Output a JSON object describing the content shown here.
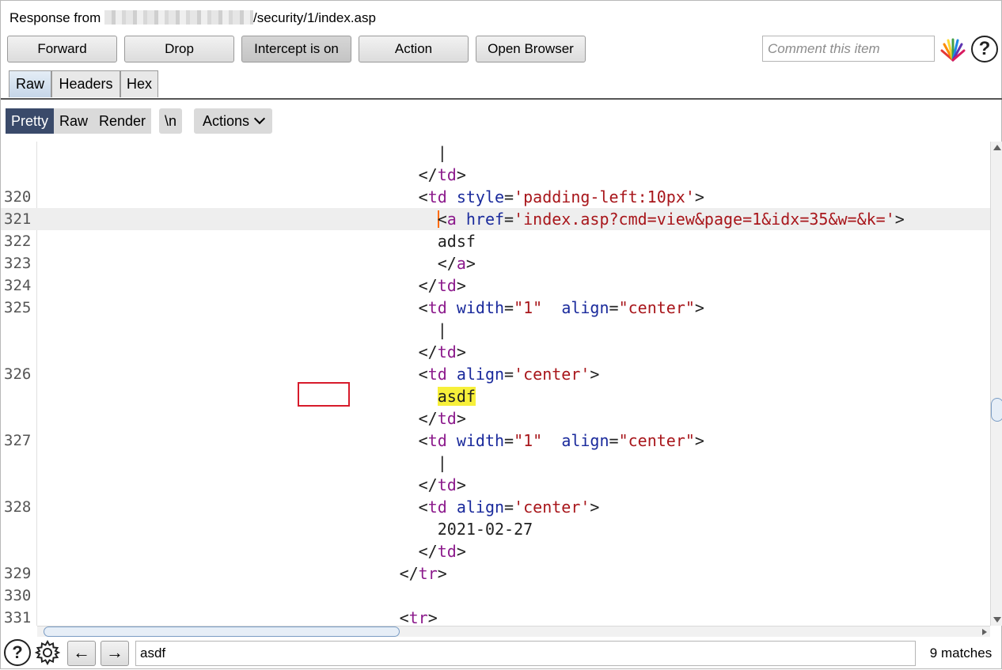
{
  "response": {
    "label_prefix": "Response from ",
    "host": "",
    "path": "/security/1/index.asp"
  },
  "toolbar": {
    "forward": "Forward",
    "drop": "Drop",
    "intercept": "Intercept is on",
    "action": "Action",
    "open_browser": "Open Browser",
    "comment_placeholder": "Comment this item"
  },
  "message_tabs": [
    "Raw",
    "Headers",
    "Hex"
  ],
  "view_tabs": {
    "pretty": "Pretty",
    "raw": "Raw",
    "render": "Render",
    "newline": "\\n",
    "actions": "Actions"
  },
  "code_lines": [
    {
      "ln": "",
      "text": "                                          |"
    },
    {
      "ln": "",
      "text": "                                        </td>"
    },
    {
      "ln": "320",
      "text": "                                        <td style='padding-left:10px'>"
    },
    {
      "ln": "321",
      "text": "                                          <a href='index.asp?cmd=view&page=1&idx=35&w=&k='>"
    },
    {
      "ln": "322",
      "text": "                                          adsf"
    },
    {
      "ln": "323",
      "text": "                                          </a>"
    },
    {
      "ln": "324",
      "text": "                                        </td>"
    },
    {
      "ln": "325",
      "text": "                                        <td width=\"1\"  align=\"center\">"
    },
    {
      "ln": "",
      "text": "                                          |"
    },
    {
      "ln": "",
      "text": "                                        </td>"
    },
    {
      "ln": "326",
      "text": "                                        <td align='center'>"
    },
    {
      "ln": "",
      "text": "                                          asdf"
    },
    {
      "ln": "",
      "text": "                                        </td>"
    },
    {
      "ln": "327",
      "text": "                                        <td width=\"1\"  align=\"center\">"
    },
    {
      "ln": "",
      "text": "                                          |"
    },
    {
      "ln": "",
      "text": "                                        </td>"
    },
    {
      "ln": "328",
      "text": "                                        <td align='center'>"
    },
    {
      "ln": "",
      "text": "                                          2021-02-27"
    },
    {
      "ln": "",
      "text": "                                        </td>"
    },
    {
      "ln": "329",
      "text": "                                      </tr>"
    },
    {
      "ln": "330",
      "text": ""
    },
    {
      "ln": "331",
      "text": "                                      <tr>"
    }
  ],
  "current_line_index": 3,
  "search": {
    "value": "asdf",
    "match_count": "9 matches"
  },
  "icons": {
    "highlight": "color-highlight-icon",
    "help": "help-icon",
    "settings": "gear-icon",
    "back": "arrow-left-icon",
    "forward": "arrow-right-icon"
  },
  "colors": {
    "tag": "#8c1a8c",
    "attribute": "#1a2a9c",
    "string": "#a8161b",
    "search_highlight": "#f7f03a",
    "active_tab": "#3a4a6a"
  }
}
